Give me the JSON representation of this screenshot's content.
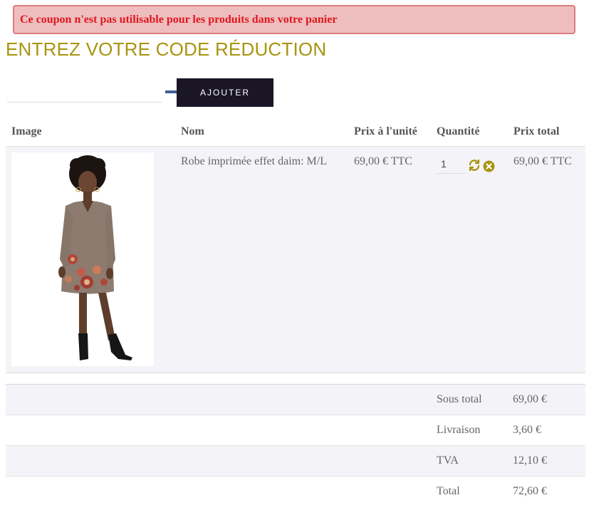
{
  "alert": {
    "message": "Ce coupon n'est pas utilisable pour les produits dans votre panier",
    "color": "#e0161e"
  },
  "coupon": {
    "title": "ENTREZ VOTRE CODE RÉDUCTION",
    "input_value": "",
    "button_label": "AJOUTER"
  },
  "cart": {
    "headers": {
      "image": "Image",
      "name": "Nom",
      "unit_price": "Prix à l'unité",
      "quantity": "Quantité",
      "total_price": "Prix total"
    },
    "items": [
      {
        "image_icon": "dress-product-photo",
        "name": "Robe imprimée effet daim: M/L",
        "unit_price": "69,00 € TTC",
        "quantity": "1",
        "total_price": "69,00 € TTC"
      }
    ]
  },
  "summary": [
    {
      "label": "Sous total",
      "value": "69,00 €"
    },
    {
      "label": "Livraison",
      "value": "3,60 €"
    },
    {
      "label": "TVA",
      "value": "12,10 €"
    },
    {
      "label": "Total",
      "value": "72,60 €"
    }
  ],
  "colors": {
    "accent": "#a89410",
    "button_bg": "#1a1626",
    "row_shade": "#f4f4f8",
    "alert_bg": "#eebebe",
    "alert_border": "#de7b7f"
  }
}
